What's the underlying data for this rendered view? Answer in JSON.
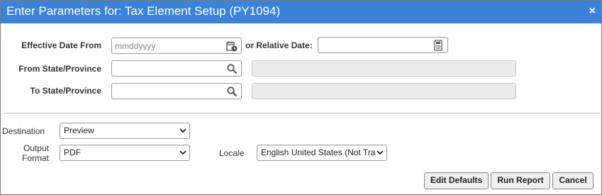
{
  "dialog": {
    "title": "Enter Parameters for: Tax Element Setup (PY1094)",
    "close_glyph": "×"
  },
  "params": {
    "effective_date_label": "Effective Date From",
    "effective_date_placeholder": "mmddyyyy",
    "effective_date_value": "",
    "relative_date_label": "or Relative Date:",
    "relative_date_value": "",
    "from_state_label": "From State/Province",
    "from_state_value": "",
    "to_state_label": "To State/Province",
    "to_state_value": ""
  },
  "output": {
    "destination_label": "Destination",
    "destination_value": "Preview",
    "output_format_label_line1": "Output",
    "output_format_label_line2": "Format",
    "output_format_value": "PDF",
    "locale_label": "Locale",
    "locale_value": "English United States (Not Tra"
  },
  "buttons": {
    "edit_defaults": "Edit Defaults",
    "run_report": "Run Report",
    "cancel": "Cancel"
  },
  "colors": {
    "title_bar": "#3b82d9",
    "icon": "#555555"
  },
  "icons": [
    "calendar-icon",
    "calculator-icon",
    "search-icon",
    "chevron-down-icon",
    "close-icon"
  ]
}
